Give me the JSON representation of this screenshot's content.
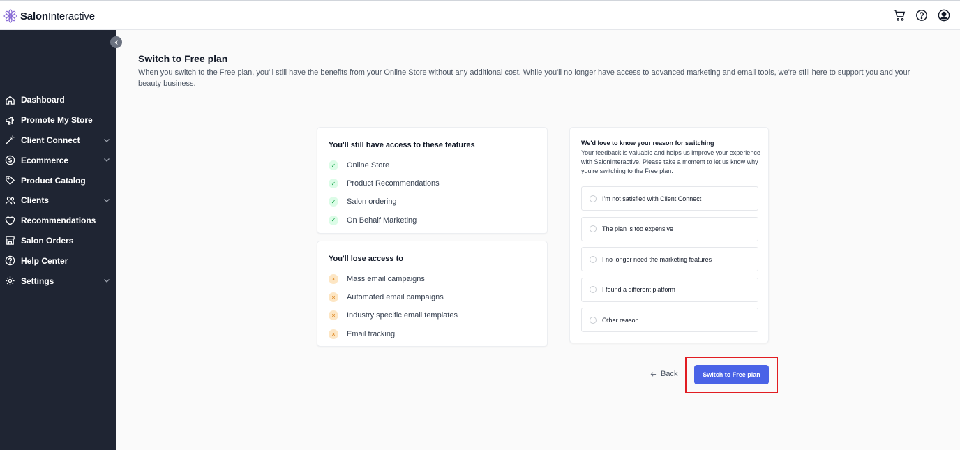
{
  "header": {
    "logo_bold": "Salon",
    "logo_rest": "Interactive",
    "icons": [
      "cart-icon",
      "help-icon",
      "account-icon"
    ]
  },
  "sidebar": {
    "items": [
      {
        "label": "Dashboard",
        "icon": "home-icon",
        "has_chevron": false
      },
      {
        "label": "Promote My Store",
        "icon": "megaphone-icon",
        "has_chevron": false
      },
      {
        "label": "Client Connect",
        "icon": "wand-icon",
        "has_chevron": true
      },
      {
        "label": "Ecommerce",
        "icon": "dollar-icon",
        "has_chevron": true
      },
      {
        "label": "Product Catalog",
        "icon": "tag-icon",
        "has_chevron": false
      },
      {
        "label": "Clients",
        "icon": "users-icon",
        "has_chevron": true
      },
      {
        "label": "Recommendations",
        "icon": "heart-icon",
        "has_chevron": false
      },
      {
        "label": "Salon Orders",
        "icon": "store-icon",
        "has_chevron": false
      },
      {
        "label": "Help Center",
        "icon": "help-circle-icon",
        "has_chevron": false
      },
      {
        "label": "Settings",
        "icon": "gear-icon",
        "has_chevron": true
      }
    ]
  },
  "main": {
    "title": "Switch to Free plan",
    "subtitle": "When you switch to the Free plan, you'll still have the benefits from your Online Store without any additional cost. While you'll no longer have access to advanced marketing and email tools, we're still here to support you and your beauty business.",
    "keep": {
      "heading": "You'll still have access to these features",
      "items": [
        "Online Store",
        "Product Recommendations",
        "Salon ordering",
        "On Behalf Marketing"
      ]
    },
    "lose": {
      "heading": "You'll lose access to",
      "items": [
        "Mass email campaigns",
        "Automated email campaigns",
        "Industry specific email templates",
        "Email tracking"
      ]
    },
    "reason": {
      "heading": "We'd love to know your reason for switching",
      "description": "Your feedback is valuable and helps us improve your experience with SalonInteractive. Please take a moment to let us know why you're switching to the Free plan.",
      "options": [
        "I'm not satisfied with Client Connect",
        "The plan is too expensive",
        "I no longer need the marketing features",
        "I found a different platform",
        "Other reason"
      ]
    },
    "back_label": "Back",
    "switch_label": "Switch to Free plan"
  },
  "colors": {
    "sidebar_bg": "#1f2533",
    "primary_button": "#4a63e7",
    "highlight_border": "#e11d22",
    "check_green": "#16a34a",
    "cross_orange": "#d97706"
  }
}
